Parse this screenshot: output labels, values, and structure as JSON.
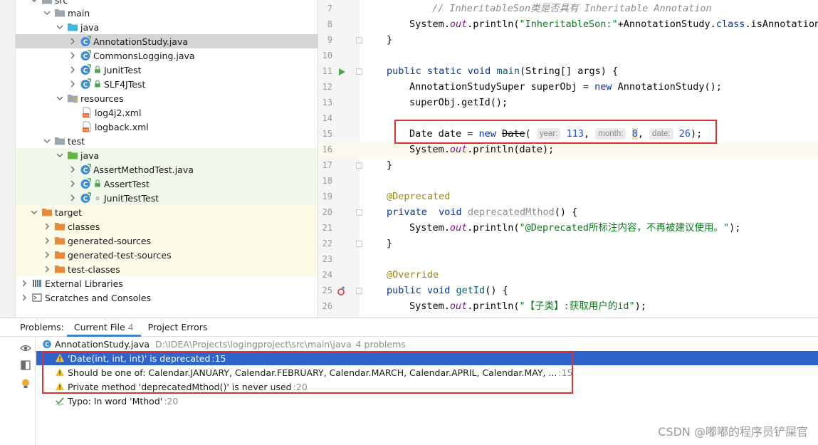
{
  "project_tree": {
    "items": [
      {
        "label": "src",
        "icon": "folder-icon",
        "expanded": true,
        "level": 1
      },
      {
        "label": "main",
        "icon": "folder-icon",
        "expanded": true,
        "level": 2
      },
      {
        "label": "java",
        "icon": "source-folder-icon",
        "expanded": true,
        "level": 3
      },
      {
        "label": "AnnotationStudy.java",
        "icon": "java-class-icon",
        "expanded": false,
        "level": 4,
        "selected": true
      },
      {
        "label": "CommonsLogging.java",
        "icon": "java-class-icon",
        "expanded": false,
        "level": 4
      },
      {
        "label": "JunitTest",
        "icon": "java-class-icon",
        "expanded": false,
        "level": 4
      },
      {
        "label": "SLF4JTest",
        "icon": "java-class-icon",
        "expanded": false,
        "level": 4
      },
      {
        "label": "resources",
        "icon": "resources-folder-icon",
        "expanded": true,
        "level": 3
      },
      {
        "label": "log4j2.xml",
        "icon": "xml-file-icon",
        "level": 4
      },
      {
        "label": "logback.xml",
        "icon": "xml-file-icon",
        "level": 4
      },
      {
        "label": "test",
        "icon": "folder-icon",
        "expanded": true,
        "level": 2
      },
      {
        "label": "java",
        "icon": "test-source-folder-icon",
        "expanded": true,
        "level": 3
      },
      {
        "label": "AssertMethodTest.java",
        "icon": "java-class-icon",
        "expanded": false,
        "level": 4
      },
      {
        "label": "AssertTest",
        "icon": "java-class-icon",
        "expanded": false,
        "level": 4
      },
      {
        "label": "JunitTestTest",
        "icon": "java-class-icon",
        "expanded": false,
        "level": 4
      },
      {
        "label": "target",
        "icon": "excluded-folder-icon",
        "expanded": true,
        "level": 1
      },
      {
        "label": "classes",
        "icon": "excluded-folder-icon",
        "expanded": false,
        "level": 2
      },
      {
        "label": "generated-sources",
        "icon": "excluded-folder-icon",
        "expanded": false,
        "level": 2
      },
      {
        "label": "generated-test-sources",
        "icon": "excluded-folder-icon",
        "expanded": false,
        "level": 2
      },
      {
        "label": "test-classes",
        "icon": "excluded-folder-icon",
        "expanded": false,
        "level": 2
      },
      {
        "label": "External Libraries",
        "icon": "library-icon",
        "expanded": false,
        "level": 0
      },
      {
        "label": "Scratches and Consoles",
        "icon": "scratches-icon",
        "expanded": false,
        "level": 0
      }
    ]
  },
  "editor": {
    "lines": [
      7,
      8,
      9,
      10,
      11,
      12,
      13,
      14,
      15,
      16,
      17,
      18,
      19,
      20,
      21,
      22,
      23,
      24,
      25,
      26
    ],
    "line7_comment": "// InheritableSon类是否具有 Inheritable Annotation",
    "line8_a": "System.",
    "line8_out": "out",
    "line8_b": ".println(",
    "line8_str": "\"InheritableSon:\"",
    "line8_c": "+AnnotationStudy.",
    "line8_class": "class",
    "line8_d": ".isAnnotationP",
    "line9": "}",
    "line11_kw": "public static void",
    "line11_mn": "main",
    "line11_rest": "(String[] args) {",
    "line12_a": "AnnotationStudySuper superObj = ",
    "line12_kw": "new",
    "line12_b": " AnnotationStudy();",
    "line13": "superObj.getId();",
    "line15_a": "Date date = ",
    "line15_kw": "new",
    "line15_dep": "Date",
    "line15_p1": "(",
    "line15_h1": "year:",
    "line15_n1": "113",
    "line15_h2": "month:",
    "line15_n2": "8",
    "line15_h3": "date:",
    "line15_n3": "26",
    "line15_end": ");",
    "line16_a": "System.",
    "line16_out": "out",
    "line16_b": ".println(date);",
    "line17": "}",
    "line19": "@Deprecated",
    "line20_kw": "private  void",
    "line20_mn": "deprecatedMthod",
    "line20_rest": "() {",
    "line21_a": "System.",
    "line21_out": "out",
    "line21_b": ".println(",
    "line21_str": "\"@Deprecated所标注内容，不再被建议使用。\"",
    "line21_c": ");",
    "line22": "}",
    "line24": "@Override",
    "line25_kw": "public void",
    "line25_mn": "getId",
    "line25_rest": "() {",
    "line26_a": "System.",
    "line26_out": "out",
    "line26_b": ".println(",
    "line26_str": "\"【子类】:获取用户的id\"",
    "line26_c": ");"
  },
  "problems": {
    "title": "Problems:",
    "tabs": [
      {
        "label": "Current File",
        "count": "4",
        "active": true
      },
      {
        "label": "Project Errors",
        "count": "",
        "active": false
      }
    ],
    "file": {
      "name": "AnnotationStudy.java",
      "path": "D:\\IDEA\\Projects\\logingproject\\src\\main\\java",
      "count": "4 problems"
    },
    "items": [
      {
        "text": "'Date(int, int, int)' is deprecated",
        "loc": ":15",
        "type": "warning",
        "selected": true
      },
      {
        "text": "Should be one of: Calendar.JANUARY, Calendar.FEBRUARY, Calendar.MARCH, Calendar.APRIL, Calendar.MAY, ...",
        "loc": ":15",
        "type": "warning"
      },
      {
        "text": "Private method 'deprecatedMthod()' is never used",
        "loc": ":20",
        "type": "warning"
      },
      {
        "text": "Typo: In word 'Mthod'",
        "loc": ":20",
        "type": "typo"
      }
    ]
  },
  "watermark": "CSDN @嘟嘟的程序员铲屎官",
  "colors": {
    "selection": "#2f65ca",
    "tab_underline": "#4083c9",
    "annotation_box": "#e03131"
  }
}
